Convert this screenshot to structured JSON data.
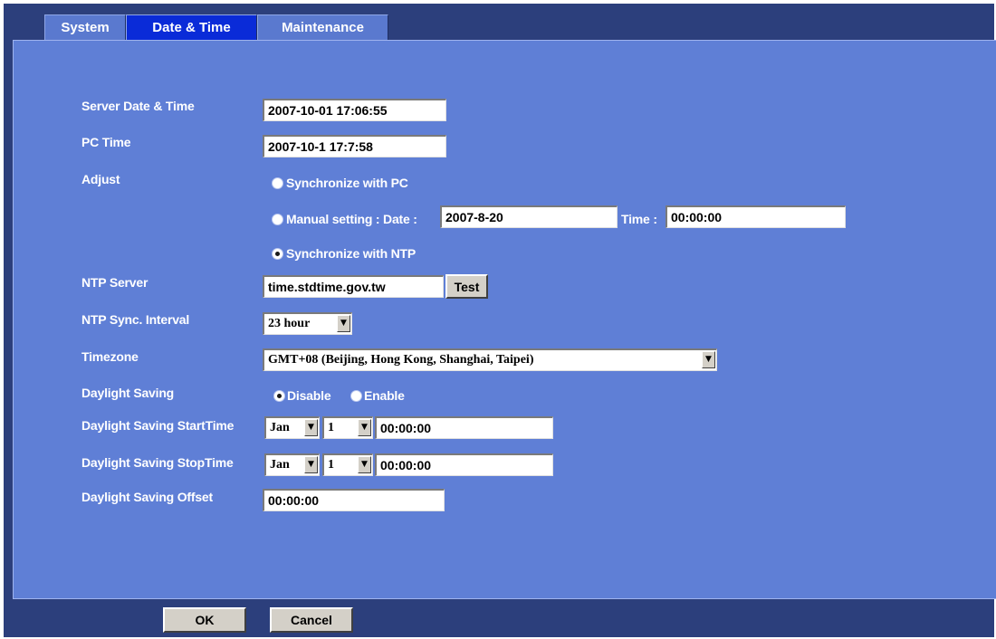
{
  "tabs": [
    {
      "label": "System"
    },
    {
      "label": "Date & Time"
    },
    {
      "label": "Maintenance"
    }
  ],
  "active_tab": "Date & Time",
  "form": {
    "server_datetime": {
      "label": "Server Date & Time",
      "value": "2007-10-01 17:06:55"
    },
    "pc_time": {
      "label": "PC Time",
      "value": "2007-10-1 17:7:58"
    },
    "adjust": {
      "label": "Adjust",
      "sync_pc_label": "Synchronize with PC",
      "manual_label": "Manual setting : Date :",
      "manual_date": "2007-8-20",
      "time_label": "Time :",
      "manual_time": "00:00:00",
      "sync_ntp_label": "Synchronize with NTP",
      "selected": "Synchronize with NTP"
    },
    "ntp_server": {
      "label": "NTP Server",
      "value": "time.stdtime.gov.tw",
      "test_label": "Test"
    },
    "ntp_interval": {
      "label": "NTP Sync. Interval",
      "value": "23 hour"
    },
    "timezone": {
      "label": "Timezone",
      "value": "GMT+08 (Beijing, Hong Kong, Shanghai, Taipei)"
    },
    "daylight_saving": {
      "label": "Daylight Saving",
      "disable_label": "Disable",
      "enable_label": "Enable",
      "selected": "Disable"
    },
    "dst_start": {
      "label": "Daylight Saving StartTime",
      "month": "Jan",
      "day": "1",
      "time": "00:00:00"
    },
    "dst_stop": {
      "label": "Daylight Saving StopTime",
      "month": "Jan",
      "day": "1",
      "time": "00:00:00"
    },
    "dst_offset": {
      "label": "Daylight Saving Offset",
      "value": "00:00:00"
    }
  },
  "buttons": {
    "ok": "OK",
    "cancel": "Cancel"
  },
  "colors": {
    "frame": "#2c3f7c",
    "panel": "#5f7fd6",
    "active_tab": "#0a2bd8",
    "inactive_tab": "#5a79cf",
    "button_face": "#d4d0c8"
  },
  "icons": {
    "dropdown_arrow": "▼"
  }
}
